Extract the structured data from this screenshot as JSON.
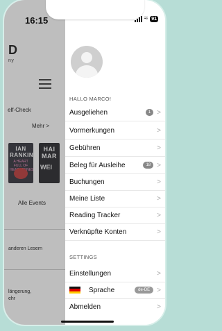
{
  "status_bar": {
    "time": "16:15",
    "battery": "91"
  },
  "background_app": {
    "logo": "D",
    "logo_sub": "ny",
    "selfcheck": "elf-Check",
    "mehr": "Mehr >",
    "book1": {
      "line1": "IAN",
      "line2": "RANKIN",
      "subtitle": "A HEART FULL OF HEADSTONES"
    },
    "book2": {
      "line1": "HAI",
      "line2": "MAR",
      "line3": "WEI"
    },
    "events": "Alle Events",
    "lesern": "anderen Lesern",
    "verlaengerung_1": "längerung,",
    "verlaengerung_2": "ehr"
  },
  "drawer": {
    "greeting": "HALLO MARCO!",
    "items": [
      {
        "label": "Ausgeliehen",
        "badge": "1"
      },
      {
        "label": "Vormerkungen"
      },
      {
        "label": "Gebühren"
      },
      {
        "label": "Beleg für Ausleihe",
        "badge": "18"
      },
      {
        "label": "Buchungen"
      },
      {
        "label": "Meine Liste"
      },
      {
        "label": "Reading Tracker"
      },
      {
        "label": "Verknüpfte Konten"
      }
    ],
    "settings_header": "SETTINGS",
    "settings": [
      {
        "label": "Einstellungen"
      },
      {
        "label": "Sprache",
        "badge": "de-DE",
        "icon": "german-flag-icon"
      },
      {
        "label": "Abmelden"
      }
    ],
    "chevron": ">"
  },
  "colors": {
    "background": "#b7ddd6",
    "badge": "#888888"
  }
}
